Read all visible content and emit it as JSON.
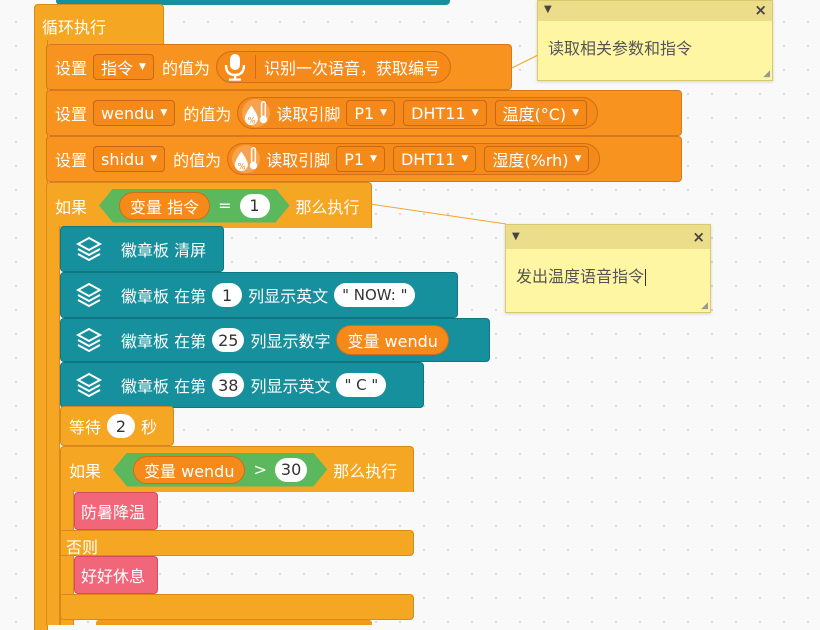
{
  "loop": {
    "label": "循环执行"
  },
  "set_cmd": {
    "set_label": "设置",
    "var_name": "指令",
    "value_label": "的值为",
    "action": "识别一次语音，获取编号",
    "icon": "microphone-icon"
  },
  "set_wendu": {
    "set_label": "设置",
    "var_name": "wendu",
    "value_label": "的值为",
    "read_label": "读取引脚",
    "pin": "P1",
    "sensor": "DHT11",
    "measure": "温度(°C)",
    "icon": "temperature-humidity-icon"
  },
  "set_shidu": {
    "set_label": "设置",
    "var_name": "shidu",
    "value_label": "的值为",
    "read_label": "读取引脚",
    "pin": "P1",
    "sensor": "DHT11",
    "measure": "湿度(%rh)",
    "icon": "temperature-humidity-icon"
  },
  "if1": {
    "if_label": "如果",
    "var_label": "变量 指令",
    "op": "=",
    "value": "1",
    "then_label": "那么执行"
  },
  "badge1": {
    "label": "徽章板 清屏"
  },
  "badge2": {
    "prefix": "徽章板 在第",
    "col": "1",
    "action": "列显示英文",
    "text": "\" NOW: \""
  },
  "badge3": {
    "prefix": "徽章板 在第",
    "col": "25",
    "action": "列显示数字",
    "var_label": "变量 wendu"
  },
  "badge4": {
    "prefix": "徽章板 在第",
    "col": "38",
    "action": "列显示英文",
    "text": "\" C \""
  },
  "wait": {
    "label": "等待",
    "value": "2",
    "unit": "秒"
  },
  "if2": {
    "if_label": "如果",
    "var_label": "变量 wendu",
    "op": ">",
    "value": "30",
    "then_label": "那么执行",
    "then_block": "防暑降温",
    "else_label": "否则",
    "else_block": "好好休息"
  },
  "notes": [
    {
      "text": "读取相关参数和指令"
    },
    {
      "text": "发出温度语音指令"
    }
  ],
  "colors": {
    "control": "#f5a623",
    "set": "#f7931e",
    "badge": "#17909e",
    "logic": "#5cb85c",
    "voice": "#f2667a",
    "note": "#fff6a4",
    "workspace": "#f9f9f9"
  }
}
